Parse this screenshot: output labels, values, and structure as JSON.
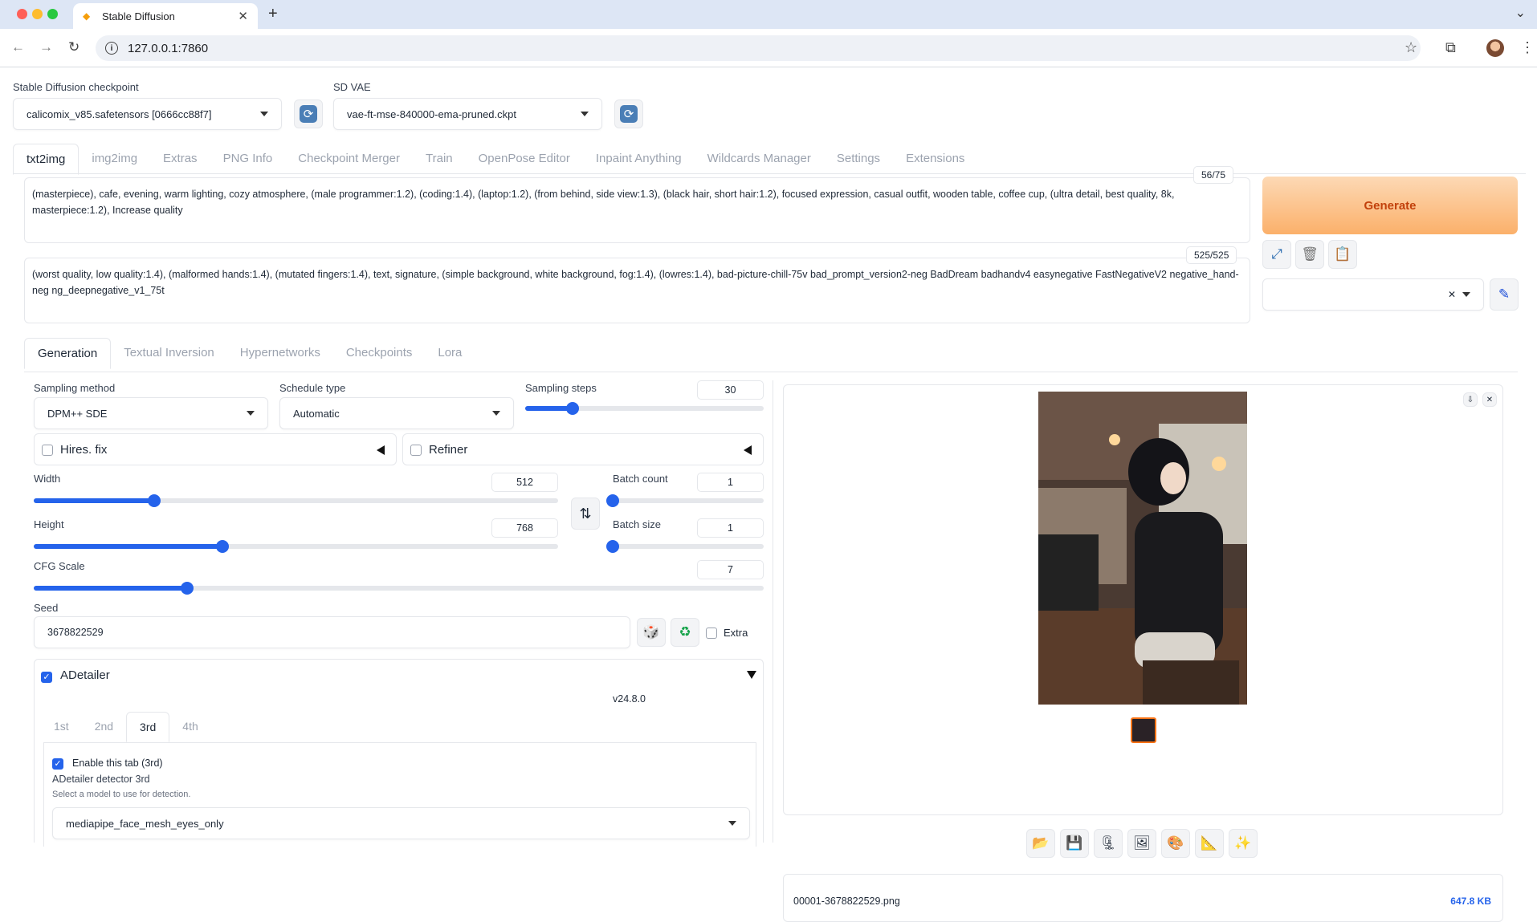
{
  "browser": {
    "tab_title": "Stable Diffusion",
    "url": "127.0.0.1:7860"
  },
  "top": {
    "checkpoint_label": "Stable Diffusion checkpoint",
    "checkpoint_value": "calicomix_v85.safetensors [0666cc88f7]",
    "vae_label": "SD VAE",
    "vae_value": "vae-ft-mse-840000-ema-pruned.ckpt"
  },
  "main_tabs": [
    "txt2img",
    "img2img",
    "Extras",
    "PNG Info",
    "Checkpoint Merger",
    "Train",
    "OpenPose Editor",
    "Inpaint Anything",
    "Wildcards Manager",
    "Settings",
    "Extensions"
  ],
  "prompt": {
    "text": "(masterpiece), cafe, evening, warm lighting, cozy atmosphere, (male programmer:1.2), (coding:1.4), (laptop:1.2), (from behind, side view:1.3), (black hair, short hair:1.2), focused expression, casual outfit, wooden table, coffee cup, (ultra detail, best quality, 8k, masterpiece:1.2), Increase quality",
    "counter": "56/75"
  },
  "negative_prompt": {
    "text": "(worst quality, low quality:1.4), (malformed hands:1.4), (mutated fingers:1.4), text, signature, (simple background, white background, fog:1.4), (lowres:1.4), bad-picture-chill-75v bad_prompt_version2-neg BadDream badhandv4 easynegative FastNegativeV2 negative_hand-neg ng_deepnegative_v1_75t",
    "counter": "525/525"
  },
  "generate_label": "Generate",
  "sub_tabs": [
    "Generation",
    "Textual Inversion",
    "Hypernetworks",
    "Checkpoints",
    "Lora"
  ],
  "generation": {
    "sampling_method_label": "Sampling method",
    "sampling_method_value": "DPM++ SDE",
    "schedule_type_label": "Schedule type",
    "schedule_type_value": "Automatic",
    "sampling_steps_label": "Sampling steps",
    "sampling_steps_value": "30",
    "sampling_steps_level": 0.2,
    "hires_label": "Hires. fix",
    "refiner_label": "Refiner",
    "width_label": "Width",
    "width_value": "512",
    "width_level": 0.23,
    "height_label": "Height",
    "height_value": "768",
    "height_level": 0.36,
    "batch_count_label": "Batch count",
    "batch_count_value": "1",
    "batch_size_label": "Batch size",
    "batch_size_value": "1",
    "cfg_label": "CFG Scale",
    "cfg_value": "7",
    "cfg_level": 0.21,
    "seed_label": "Seed",
    "seed_value": "3678822529",
    "extra_label": "Extra"
  },
  "adetailer": {
    "label": "ADetailer",
    "version": "v24.8.0",
    "tabs": [
      "1st",
      "2nd",
      "3rd",
      "4th"
    ],
    "enable_label": "Enable this tab (3rd)",
    "detector_label": "ADetailer detector 3rd",
    "detector_hint": "Select a model to use for detection.",
    "detector_value": "mediapipe_face_mesh_eyes_only"
  },
  "output": {
    "filename": "00001-3678822529.png",
    "filesize": "647.8 KB"
  },
  "colors": {
    "accent": "#2563eb",
    "generate_text": "#c2410c",
    "generate_bg": "#fbb06a"
  }
}
